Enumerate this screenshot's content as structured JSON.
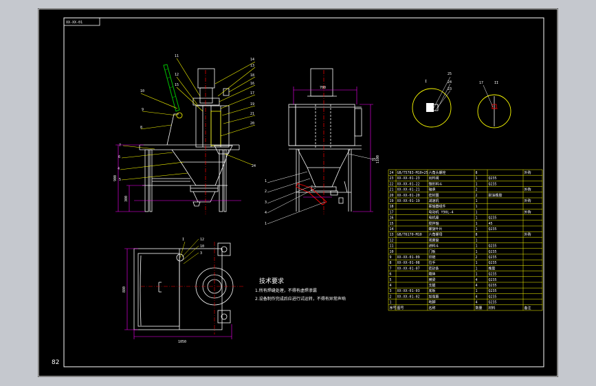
{
  "frame": {
    "sheet_tag": "XX-XX-01",
    "page_number": "82"
  },
  "tech_requirements": {
    "title": "技术要求",
    "items": [
      "1.所有焊缝处理，不得有虚焊渗漏",
      "2.设备制作完成后应进行试运转，不得有异常声响"
    ]
  },
  "dims": {
    "front_height": "900",
    "front_leg": "300",
    "side_top": "700",
    "side_height": "1100",
    "plan_depth": "880",
    "plan_width": "1050"
  },
  "colors": {
    "frame": "#ffffff",
    "outline": "#ffffff",
    "leader": "#ffff00",
    "dimension": "#ff00ff",
    "hatch": "#00c000",
    "section": "#ff0000",
    "fill_gray": "#c8c8c8",
    "table_grid": "#ffff00"
  },
  "bom": {
    "header": [
      "序号",
      "图号",
      "名称",
      "数量",
      "材料",
      "备注"
    ],
    "rows": [
      [
        "24",
        "GB/T5783-M10×25",
        "六角头螺栓",
        "8",
        "",
        "外购"
      ],
      [
        "23",
        "XX-XX-01-23",
        "出料阀",
        "1",
        "Q235",
        ""
      ],
      [
        "22",
        "XX-XX-01-22",
        "锥形料斗",
        "1",
        "Q235",
        ""
      ],
      [
        "21",
        "XX-XX-01-21",
        "轴承",
        "2",
        "",
        "外购"
      ],
      [
        "20",
        "XX-XX-01-20",
        "密封圈",
        "2",
        "耐油橡胶",
        ""
      ],
      [
        "19",
        "XX-XX-01-19",
        "减速机",
        "1",
        "",
        "外购"
      ],
      [
        "18",
        "",
        "联轴器组件",
        "1",
        "",
        ""
      ],
      [
        "17",
        "",
        "电动机 Y90L-4",
        "1",
        "",
        "外购"
      ],
      [
        "16",
        "",
        "电机座",
        "1",
        "Q235",
        ""
      ],
      [
        "15",
        "",
        "搅拌轴",
        "1",
        "45",
        ""
      ],
      [
        "14",
        "",
        "螺旋叶片",
        "1",
        "Q235",
        ""
      ],
      [
        "13",
        "GB/T6170-M10",
        "六角螺母",
        "8",
        "",
        "外购"
      ],
      [
        "12",
        "",
        "观察窗",
        "1",
        "",
        ""
      ],
      [
        "11",
        "",
        "进料斗",
        "1",
        "Q235",
        ""
      ],
      [
        "10",
        "",
        "门板",
        "1",
        "Q235",
        ""
      ],
      [
        "9",
        "XX-XX-01-09",
        "铰链",
        "2",
        "Q235",
        ""
      ],
      [
        "8",
        "XX-XX-01-08",
        "拉手",
        "1",
        "Q235",
        ""
      ],
      [
        "7",
        "XX-XX-01-07",
        "密封条",
        "1",
        "橡胶",
        ""
      ],
      [
        "6",
        "",
        "箱体",
        "1",
        "Q235",
        ""
      ],
      [
        "5",
        "",
        "横梁",
        "4",
        "Q235",
        ""
      ],
      [
        "4",
        "",
        "支腿",
        "4",
        "Q235",
        ""
      ],
      [
        "3",
        "XX-XX-01-03",
        "底板",
        "1",
        "Q235",
        ""
      ],
      [
        "2",
        "XX-XX-01-02",
        "加强筋",
        "4",
        "Q235",
        ""
      ],
      [
        "1",
        "",
        "地脚",
        "4",
        "Q235",
        ""
      ]
    ]
  }
}
